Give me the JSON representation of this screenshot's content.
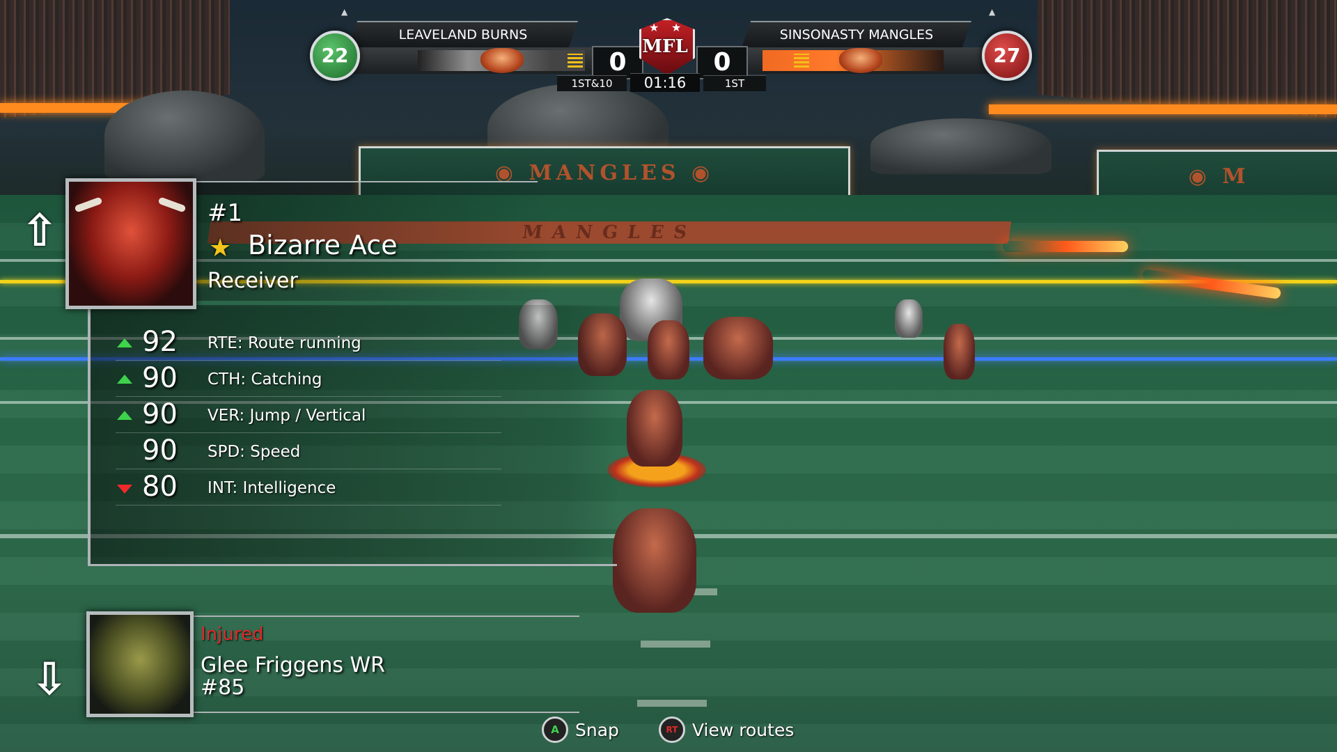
{
  "scoreboard": {
    "home_team": "LEAVELAND BURNS",
    "away_team": "SINSONASTY MANGLES",
    "home_score": "0",
    "away_score": "0",
    "home_rating": "22",
    "away_rating": "27",
    "league_logo": "MFL",
    "down_distance": "1ST&10",
    "clock": "01:16",
    "quarter": "1ST",
    "home_color": "#3a9a4a",
    "away_color": "#d42a2a"
  },
  "player": {
    "number": "#1",
    "name": "Bizarre Ace",
    "position": "Receiver",
    "star_icon": "star-icon",
    "stats": [
      {
        "value": "92",
        "label": "RTE: Route running",
        "trend": "up"
      },
      {
        "value": "90",
        "label": "CTH: Catching",
        "trend": "up"
      },
      {
        "value": "90",
        "label": "VER: Jump / Vertical",
        "trend": "up"
      },
      {
        "value": "90",
        "label": "SPD: Speed",
        "trend": "none"
      },
      {
        "value": "80",
        "label": "INT: Intelligence",
        "trend": "down"
      }
    ]
  },
  "alternate_player": {
    "status": "Injured",
    "name": "Glee Friggens WR",
    "number": "#85"
  },
  "prompts": [
    {
      "button": "A",
      "label": "Snap"
    },
    {
      "button": "RT",
      "label": "View routes"
    }
  ],
  "colors": {
    "trend_up": "#3ed34c",
    "trend_down": "#f02a2a",
    "injured": "#e02a2a",
    "star": "#f3c41b"
  }
}
